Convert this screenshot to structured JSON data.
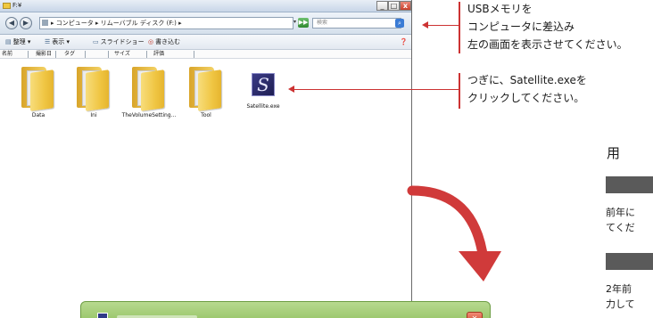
{
  "window": {
    "title": "F:¥",
    "minimize": "_",
    "maximize": "□",
    "close": "x"
  },
  "address_bar": {
    "back": "◀",
    "forward": "▶",
    "path": "▸ コンピュータ ▸ リムーバブル ディスク (F:) ▸",
    "dropdown": "▾",
    "refresh": "▶▶",
    "search_placeholder": "検索",
    "search_button": "⌕"
  },
  "toolbar": {
    "organize": "整理 ▾",
    "view": "表示 ▾",
    "slideshow": "スライドショー",
    "burn": "書き込む",
    "help": "❓"
  },
  "columns": [
    "名前",
    "撮影日",
    "タグ",
    "サイズ",
    "評価"
  ],
  "files": [
    {
      "name": "Data",
      "kind": "folder"
    },
    {
      "name": "Ini",
      "kind": "folder"
    },
    {
      "name": "TheVolumeSetting...",
      "kind": "folder"
    },
    {
      "name": "Tool",
      "kind": "folder"
    },
    {
      "name": "Satellite.exe",
      "kind": "app",
      "glyph": "S"
    }
  ],
  "annotations": {
    "step1": [
      "USBメモリを",
      "コンピュータに差込み",
      "左の画面を表示させてください。"
    ],
    "step2": [
      "つぎに、Satellite.exeを",
      "クリックしてください。"
    ]
  },
  "right_panel": {
    "heading": "用",
    "text1": [
      "前年に",
      "てくだ"
    ],
    "text2": [
      "2年前",
      "力して"
    ]
  },
  "dialog": {
    "close": "✕"
  },
  "colors": {
    "accent_red": "#cc3333",
    "folder_yellow": "#f0c644",
    "dialog_green": "#8fc05e"
  }
}
